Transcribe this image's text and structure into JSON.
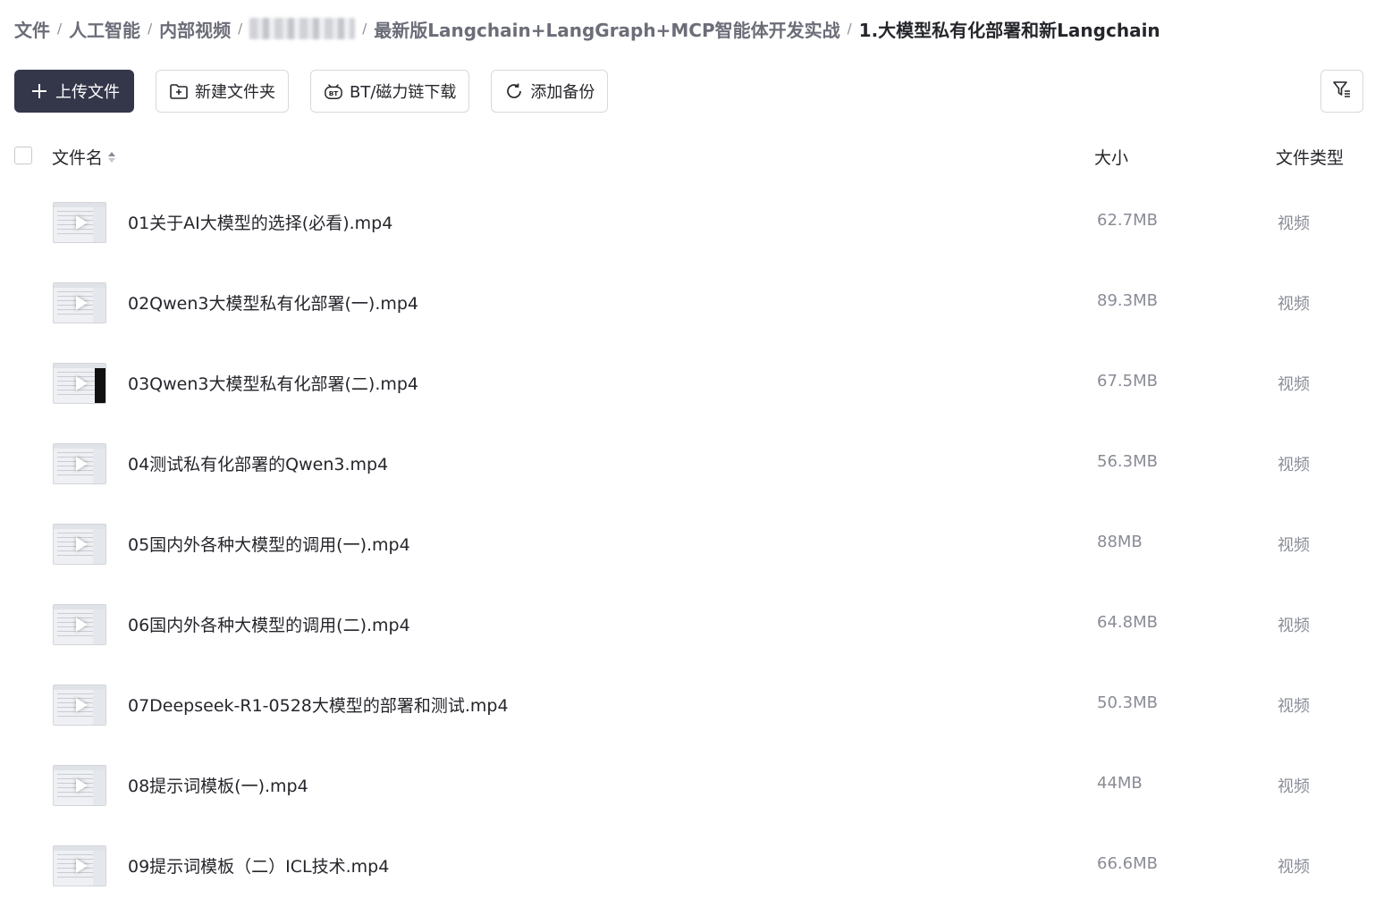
{
  "breadcrumb": {
    "items": [
      "文件",
      "人工智能",
      "内部视频",
      "最新版Langchain+LangGraph+MCP智能体开发实战"
    ],
    "current": "1.大模型私有化部署和新Langchain",
    "separator": "/"
  },
  "toolbar": {
    "upload_label": "上传文件",
    "new_folder_label": "新建文件夹",
    "bt_label": "BT/磁力链下载",
    "backup_label": "添加备份"
  },
  "table": {
    "headers": {
      "name": "文件名",
      "size": "大小",
      "type": "文件类型"
    },
    "rows": [
      {
        "name": "01关于AI大模型的选择(必看).mp4",
        "size": "62.7MB",
        "type": "视频"
      },
      {
        "name": "02Qwen3大模型私有化部署(一).mp4",
        "size": "89.3MB",
        "type": "视频"
      },
      {
        "name": "03Qwen3大模型私有化部署(二).mp4",
        "size": "67.5MB",
        "type": "视频"
      },
      {
        "name": "04测试私有化部署的Qwen3.mp4",
        "size": "56.3MB",
        "type": "视频"
      },
      {
        "name": "05国内外各种大模型的调用(一).mp4",
        "size": "88MB",
        "type": "视频"
      },
      {
        "name": "06国内外各种大模型的调用(二).mp4",
        "size": "64.8MB",
        "type": "视频"
      },
      {
        "name": "07Deepseek-R1-0528大模型的部署和测试.mp4",
        "size": "50.3MB",
        "type": "视频"
      },
      {
        "name": "08提示词模板(一).mp4",
        "size": "44MB",
        "type": "视频"
      },
      {
        "name": "09提示词模板（二）ICL技术.mp4",
        "size": "66.6MB",
        "type": "视频"
      }
    ]
  },
  "colors": {
    "primary_button": "#34364a",
    "muted_text": "#8a8c96",
    "text": "#25262b"
  },
  "icons": [
    "plus-icon",
    "new-folder-icon",
    "bt-icon",
    "backup-icon",
    "filter-icon",
    "sort-icon",
    "video-thumbnail"
  ]
}
